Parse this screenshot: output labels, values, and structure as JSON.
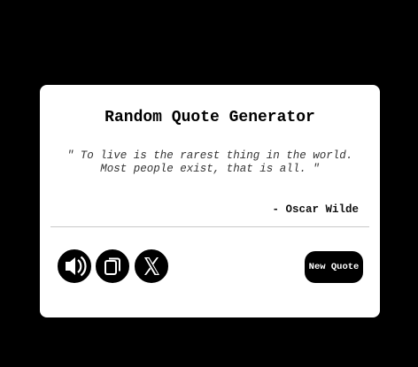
{
  "app": {
    "title": "Random Quote Generator"
  },
  "quote": {
    "text": "\" To live is the rarest thing in the world. Most people exist, that is all. \"",
    "author": "- Oscar Wilde"
  },
  "actions": {
    "speech_icon": "speaker-icon",
    "copy_icon": "copy-icon",
    "twitter_icon": "x-twitter-icon",
    "new_quote_label": "New Quote"
  },
  "colors": {
    "background": "#000000",
    "card": "#ffffff",
    "accent": "#000000"
  }
}
